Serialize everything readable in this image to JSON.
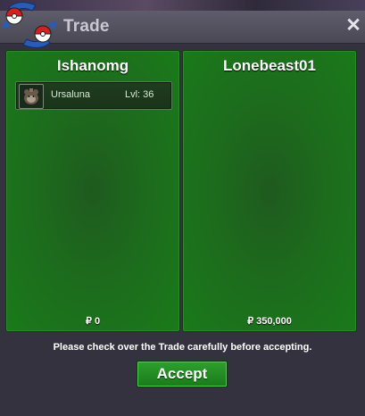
{
  "window": {
    "title": "Trade",
    "close_icon": "close-icon",
    "logo_icon": "pokeball-swap-logo"
  },
  "left_panel": {
    "player_name": "Ishanomg",
    "pokemon": [
      {
        "name": "Ursaluna",
        "level": "Lvl: 36",
        "icon": "ursaluna-sprite"
      }
    ],
    "money": "₽ 0"
  },
  "right_panel": {
    "player_name": "Lonebeast01",
    "pokemon": [],
    "money": "₽ 350,000"
  },
  "notice": "Please check over the Trade carefully before accepting.",
  "accept_label": "Accept",
  "colors": {
    "panel_green": "#1d6b1d",
    "button_green": "#2ea02e",
    "titlebar": "#55535f",
    "background": "#34323f"
  }
}
